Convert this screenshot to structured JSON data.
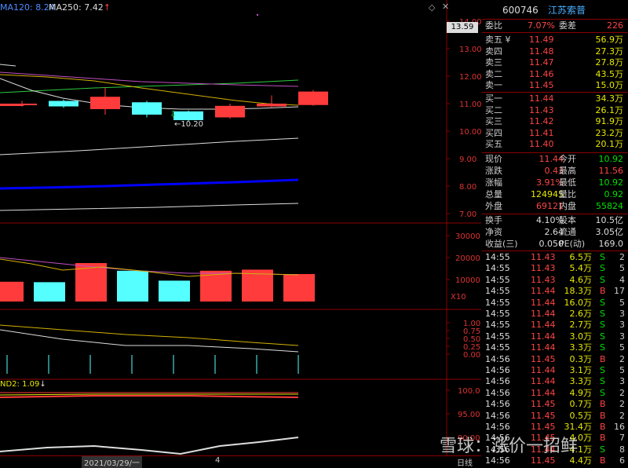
{
  "header": {
    "ma120_label": "MA120: 8.24",
    "ma250_label": "MA250: 7.42",
    "arrow": "↑"
  },
  "main_chart": {
    "price_axis": [
      "14.00",
      "13.00",
      "12.00",
      "11.00",
      "10.00",
      "9.00",
      "8.00",
      "7.00"
    ],
    "current_price_tag": "13.59",
    "low_marker": "←10.20",
    "candles": [
      {
        "open": 11.0,
        "close": 10.95,
        "high": 11.1,
        "low": 10.9,
        "color": "red"
      },
      {
        "open": 11.1,
        "close": 10.9,
        "high": 11.15,
        "low": 10.85,
        "color": "cyan"
      },
      {
        "open": 10.8,
        "close": 11.25,
        "high": 11.6,
        "low": 10.6,
        "color": "red"
      },
      {
        "open": 11.05,
        "close": 10.6,
        "high": 11.1,
        "low": 10.5,
        "color": "cyan"
      },
      {
        "open": 10.72,
        "close": 10.4,
        "high": 10.75,
        "low": 10.35,
        "color": "cyan"
      },
      {
        "open": 10.5,
        "close": 10.92,
        "high": 11.0,
        "low": 10.45,
        "color": "red"
      },
      {
        "open": 10.9,
        "close": 11.0,
        "high": 11.3,
        "low": 10.85,
        "color": "red"
      },
      {
        "open": 10.95,
        "close": 11.44,
        "high": 11.5,
        "low": 10.92,
        "color": "red"
      }
    ]
  },
  "volume_chart": {
    "axis": [
      "30000",
      "20000",
      "10000"
    ],
    "unit": "X10",
    "bars": [
      {
        "value": 9000,
        "color": "red"
      },
      {
        "value": 8800,
        "color": "cyan"
      },
      {
        "value": 17500,
        "color": "red"
      },
      {
        "value": 14000,
        "color": "cyan"
      },
      {
        "value": 9500,
        "color": "cyan"
      },
      {
        "value": 14000,
        "color": "red"
      },
      {
        "value": 14500,
        "color": "red"
      },
      {
        "value": 12500,
        "color": "red"
      }
    ]
  },
  "indicator1": {
    "axis": [
      "1.00",
      "0.75",
      "0.50",
      "0.25",
      "0.00"
    ]
  },
  "indicator2": {
    "label": "ND2: 1.09",
    "arrow": "↓",
    "axis": [
      "100.0",
      "95.00",
      "90.00"
    ]
  },
  "date_axis": {
    "date": "2021/03/29/一",
    "tick": "4",
    "day_label": "日线"
  },
  "quote_panel": {
    "code": "600746",
    "name": "江苏索普",
    "weibi_label": "委比",
    "weibi_value": "7.07%",
    "weicha_label": "委差",
    "weicha_value": "226",
    "asks": [
      {
        "label": "卖五 ¥",
        "price": "11.49",
        "vol": "56.9万"
      },
      {
        "label": "卖四",
        "price": "11.48",
        "vol": "27.3万"
      },
      {
        "label": "卖三",
        "price": "11.47",
        "vol": "27.8万"
      },
      {
        "label": "卖二",
        "price": "11.46",
        "vol": "43.5万"
      },
      {
        "label": "卖一",
        "price": "11.45",
        "vol": "15.0万"
      }
    ],
    "bids": [
      {
        "label": "买一",
        "price": "11.44",
        "vol": "34.3万"
      },
      {
        "label": "买二",
        "price": "11.43",
        "vol": "26.1万"
      },
      {
        "label": "买三",
        "price": "11.42",
        "vol": "91.9万"
      },
      {
        "label": "买四",
        "price": "11.41",
        "vol": "23.2万"
      },
      {
        "label": "买五",
        "price": "11.40",
        "vol": "20.1万"
      }
    ],
    "stats": [
      {
        "l1": "现价",
        "v1": "11.44",
        "c1": "#ff4444",
        "l2": "今开",
        "v2": "10.92",
        "c2": "#00e000"
      },
      {
        "l1": "涨跌",
        "v1": "0.43",
        "c1": "#ff4444",
        "l2": "最高",
        "v2": "11.56",
        "c2": "#ff4444"
      },
      {
        "l1": "涨幅",
        "v1": "3.91%",
        "c1": "#ff4444",
        "l2": "最低",
        "v2": "10.92",
        "c2": "#00e000"
      },
      {
        "l1": "总量",
        "v1": "124945",
        "c1": "#e8e800",
        "l2": "量比",
        "v2": "0.92",
        "c2": "#00e000"
      },
      {
        "l1": "外盘",
        "v1": "69121",
        "c1": "#ff4444",
        "l2": "内盘",
        "v2": "55824",
        "c2": "#00e000"
      }
    ],
    "stats2": [
      {
        "l1": "换手",
        "v1": "4.10%",
        "l2": "股本",
        "v2": "10.5亿"
      },
      {
        "l1": "净资",
        "v1": "2.64",
        "l2": "流通",
        "v2": "3.05亿"
      },
      {
        "l1": "收益(三)",
        "v1": "0.050",
        "l2": "PE(动)",
        "v2": "169.0"
      }
    ],
    "ticks": [
      {
        "time": "14:55",
        "price": "11.43",
        "vol": "6.5万",
        "side": "S",
        "n": "2"
      },
      {
        "time": "14:55",
        "price": "11.43",
        "vol": "5.4万",
        "side": "S",
        "n": "5"
      },
      {
        "time": "14:55",
        "price": "11.43",
        "vol": "4.6万",
        "side": "S",
        "n": "4"
      },
      {
        "time": "14:55",
        "price": "11.44",
        "vol": "18.3万",
        "side": "B",
        "n": "17"
      },
      {
        "time": "14:55",
        "price": "11.44",
        "vol": "16.0万",
        "side": "S",
        "n": "5"
      },
      {
        "time": "14:55",
        "price": "11.44",
        "vol": "2.6万",
        "side": "S",
        "n": "3"
      },
      {
        "time": "14:55",
        "price": "11.44",
        "vol": "2.7万",
        "side": "S",
        "n": "3"
      },
      {
        "time": "14:55",
        "price": "11.44",
        "vol": "3.0万",
        "side": "S",
        "n": "3"
      },
      {
        "time": "14:55",
        "price": "11.44",
        "vol": "3.3万",
        "side": "S",
        "n": "5"
      },
      {
        "time": "14:56",
        "price": "11.45",
        "vol": "0.3万",
        "side": "B",
        "n": "2"
      },
      {
        "time": "14:56",
        "price": "11.44",
        "vol": "3.1万",
        "side": "S",
        "n": "5"
      },
      {
        "time": "14:56",
        "price": "11.44",
        "vol": "3.3万",
        "side": "S",
        "n": "3"
      },
      {
        "time": "14:56",
        "price": "11.44",
        "vol": "4.9万",
        "side": "S",
        "n": "2"
      },
      {
        "time": "14:56",
        "price": "11.45",
        "vol": "0.7万",
        "side": "B",
        "n": "2"
      },
      {
        "time": "14:56",
        "price": "11.45",
        "vol": "0.5万",
        "side": "B",
        "n": "2"
      },
      {
        "time": "14:56",
        "price": "11.45",
        "vol": "31.4万",
        "side": "B",
        "n": "16"
      },
      {
        "time": "14:56",
        "price": "11.45",
        "vol": "4.0万",
        "side": "B",
        "n": "7"
      },
      {
        "time": "14:56",
        "price": "11.44",
        "vol": "4.1万",
        "side": "S",
        "n": "8"
      },
      {
        "time": "14:56",
        "price": "11.45",
        "vol": "4.4万",
        "side": "B",
        "n": "6"
      }
    ]
  },
  "watermark": "雪球：涨价一招鲜"
}
